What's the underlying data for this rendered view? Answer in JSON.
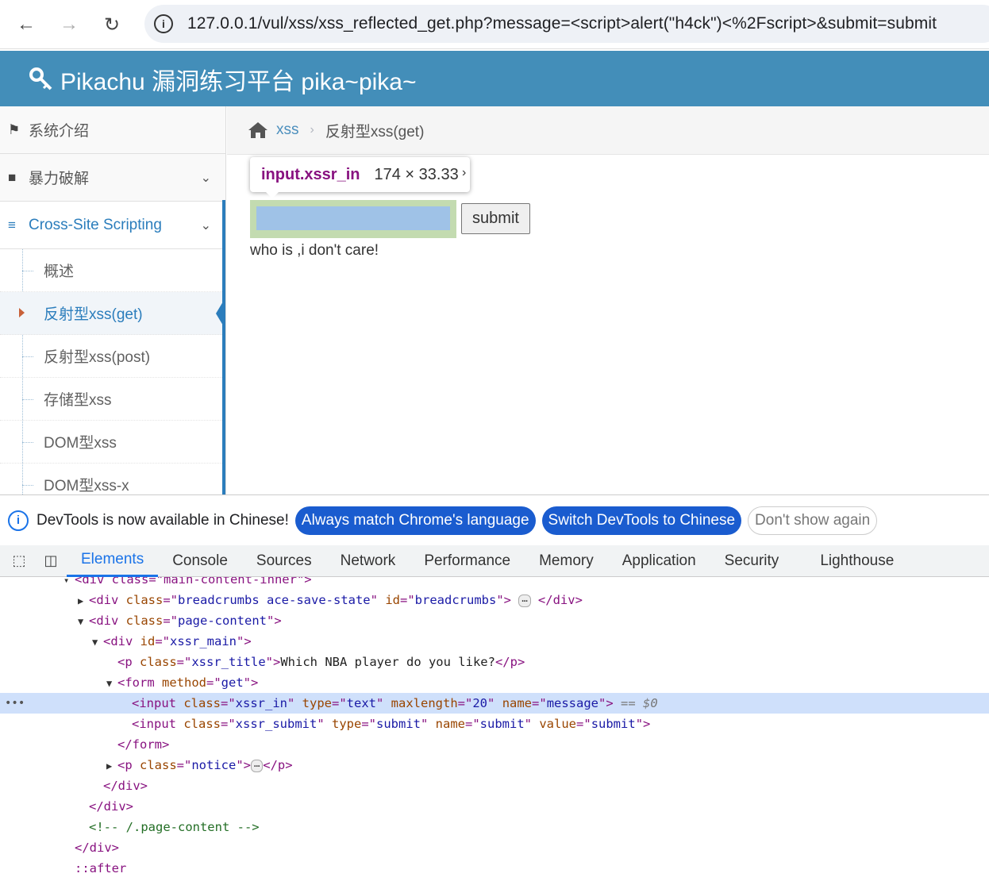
{
  "browser": {
    "url": "127.0.0.1/vul/xss/xss_reflected_get.php?message=<script>alert(\"h4ck\")<%2Fscript>&submit=submit"
  },
  "header": {
    "brand": "Pikachu 漏洞练习平台 pika~pika~"
  },
  "sidebar": {
    "items": [
      {
        "label": "系统介绍",
        "icon": "tags-icon"
      },
      {
        "label": "暴力破解",
        "icon": "lock-icon"
      },
      {
        "label": "Cross-Site Scripting",
        "icon": "list-tree-icon"
      }
    ],
    "submenu": [
      {
        "label": "概述"
      },
      {
        "label": "反射型xss(get)"
      },
      {
        "label": "反射型xss(post)"
      },
      {
        "label": "存储型xss"
      },
      {
        "label": "DOM型xss"
      },
      {
        "label": "DOM型xss-x"
      }
    ]
  },
  "breadcrumbs": {
    "link": "xss",
    "current": "反射型xss(get)"
  },
  "main": {
    "tooltip_tag": "input.xssr_in",
    "tooltip_dims": "174 × 33.33",
    "submit_label": "submit",
    "notice": "who is ,i don't care!"
  },
  "devtools": {
    "banner_text": "DevTools is now available in Chinese!",
    "btn_match": "Always match Chrome's language",
    "btn_switch": "Switch DevTools to Chinese",
    "btn_dismiss": "Don't show again",
    "tabs": [
      "Elements",
      "Console",
      "Sources",
      "Network",
      "Performance",
      "Memory",
      "Application",
      "Security",
      "Lighthouse"
    ],
    "dom": {
      "line0_cut": "div class=\"main-content-inner\">",
      "bc_class": "breadcrumbs ace-save-state",
      "bc_id": "breadcrumbs",
      "pc_class": "page-content",
      "main_id": "xssr_main",
      "title_class": "xssr_title",
      "title_text": "Which NBA player do you like?",
      "form_method": "get",
      "in_class": "xssr_in",
      "in_type": "text",
      "in_maxlength": "20",
      "in_name": "message",
      "sel_marker": "== $0",
      "sub_class": "xssr_submit",
      "sub_type": "submit",
      "sub_name": "submit",
      "sub_value": "submit",
      "notice_class": "notice",
      "comment": "<!-- /.page-content -->",
      "after": "::after"
    }
  }
}
